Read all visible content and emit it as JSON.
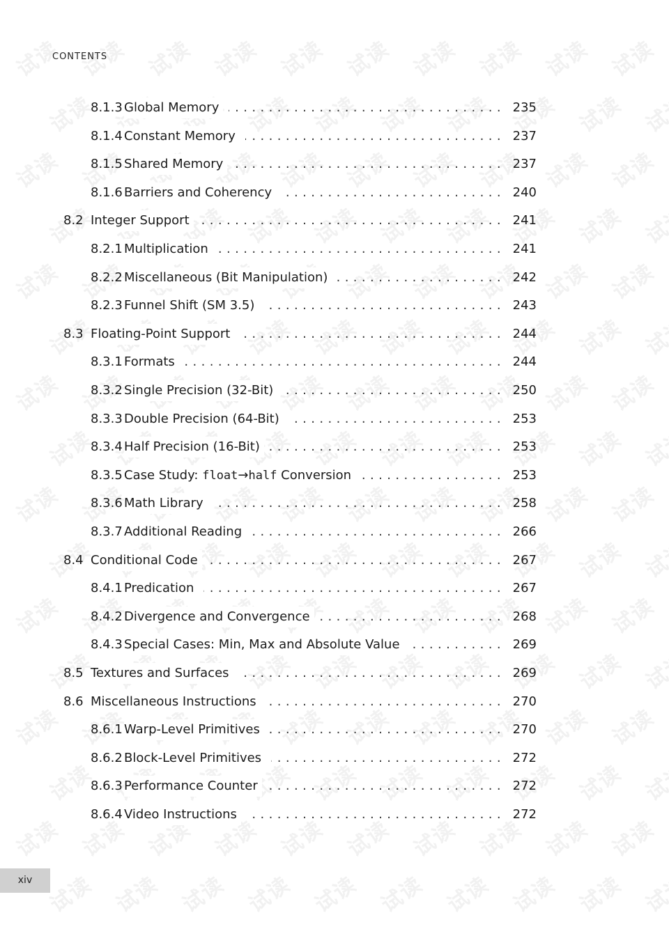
{
  "header": {
    "running_head": "CONTENTS"
  },
  "watermark": {
    "text": "试读"
  },
  "toc": [
    {
      "level": 2,
      "number": "8.1.3",
      "title": "Global Memory",
      "page": "235"
    },
    {
      "level": 2,
      "number": "8.1.4",
      "title": "Constant Memory",
      "page": "237"
    },
    {
      "level": 2,
      "number": "8.1.5",
      "title": "Shared Memory",
      "page": "237"
    },
    {
      "level": 2,
      "number": "8.1.6",
      "title": "Barriers and Coherency",
      "page": "240"
    },
    {
      "level": 1,
      "number": "8.2",
      "title": "Integer Support",
      "page": "241"
    },
    {
      "level": 2,
      "number": "8.2.1",
      "title": "Multiplication",
      "page": "241"
    },
    {
      "level": 2,
      "number": "8.2.2",
      "title": "Miscellaneous (Bit Manipulation)",
      "page": "242"
    },
    {
      "level": 2,
      "number": "8.2.3",
      "title": "Funnel Shift (SM 3.5)",
      "page": "243"
    },
    {
      "level": 1,
      "number": "8.3",
      "title": "Floating-Point Support",
      "page": "244"
    },
    {
      "level": 2,
      "number": "8.3.1",
      "title": "Formats",
      "page": "244"
    },
    {
      "level": 2,
      "number": "8.3.2",
      "title": "Single Precision (32-Bit)",
      "page": "250"
    },
    {
      "level": 2,
      "number": "8.3.3",
      "title": "Double Precision (64-Bit)",
      "page": "253"
    },
    {
      "level": 2,
      "number": "8.3.4",
      "title": "Half Precision (16-Bit)",
      "page": "253"
    },
    {
      "level": 2,
      "number": "8.3.5",
      "title_parts": [
        {
          "text": "Case Study: ",
          "mono": false
        },
        {
          "text": "float",
          "mono": true
        },
        {
          "text": "→",
          "mono": false
        },
        {
          "text": "half",
          "mono": true
        },
        {
          "text": " Conversion",
          "mono": false
        }
      ],
      "title": "Case Study: float→half Conversion",
      "page": "253"
    },
    {
      "level": 2,
      "number": "8.3.6",
      "title": "Math Library",
      "page": "258"
    },
    {
      "level": 2,
      "number": "8.3.7",
      "title": "Additional Reading",
      "page": "266"
    },
    {
      "level": 1,
      "number": "8.4",
      "title": "Conditional Code",
      "page": "267"
    },
    {
      "level": 2,
      "number": "8.4.1",
      "title": "Predication",
      "page": "267"
    },
    {
      "level": 2,
      "number": "8.4.2",
      "title": "Divergence and Convergence",
      "page": "268"
    },
    {
      "level": 2,
      "number": "8.4.3",
      "title": "Special Cases: Min, Max and Absolute Value",
      "page": "269"
    },
    {
      "level": 1,
      "number": "8.5",
      "title": "Textures and Surfaces",
      "page": "269"
    },
    {
      "level": 1,
      "number": "8.6",
      "title": "Miscellaneous Instructions",
      "page": "270"
    },
    {
      "level": 2,
      "number": "8.6.1",
      "title": "Warp-Level Primitives",
      "page": "270"
    },
    {
      "level": 2,
      "number": "8.6.2",
      "title": "Block-Level Primitives",
      "page": "272"
    },
    {
      "level": 2,
      "number": "8.6.3",
      "title": "Performance Counter",
      "page": "272"
    },
    {
      "level": 2,
      "number": "8.6.4",
      "title": "Video Instructions",
      "page": "272"
    }
  ],
  "footer": {
    "folio": "xiv"
  }
}
